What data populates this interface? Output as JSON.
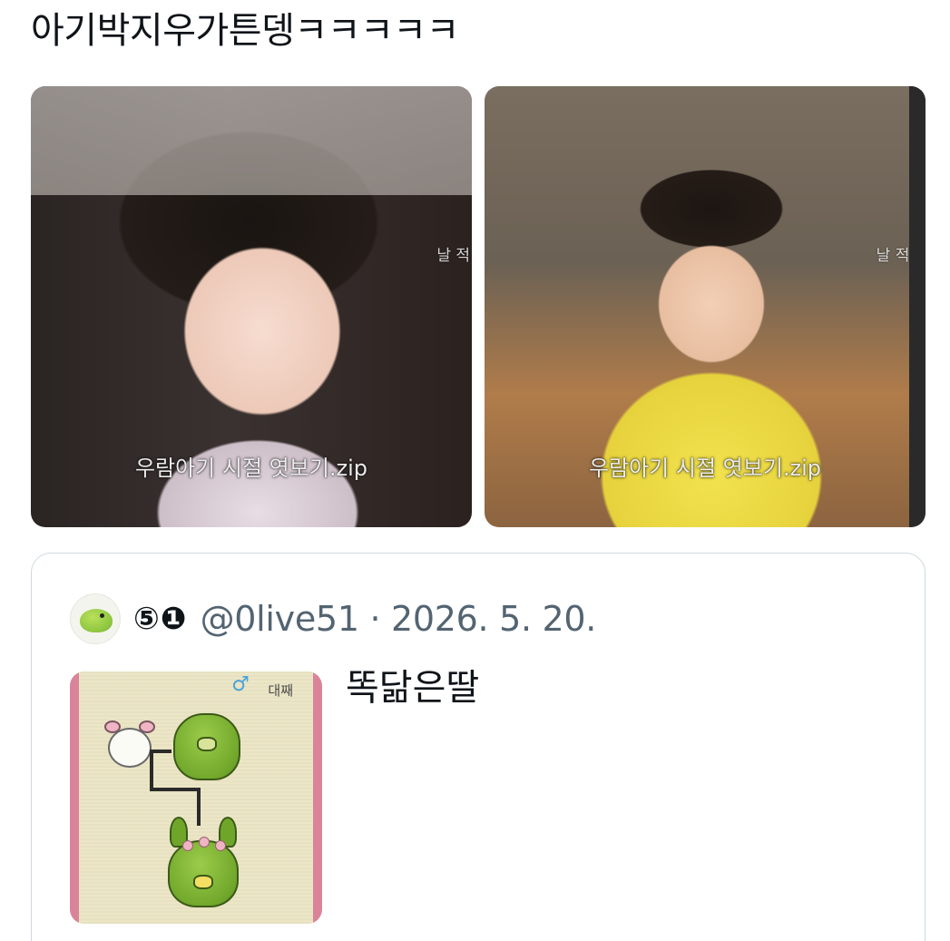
{
  "tweet": {
    "text": "아기박지우가튼뎅ㅋㅋㅋㅋㅋ"
  },
  "media": [
    {
      "caption": "우람아기 시절 엿보기.zip",
      "watermark": "날 적"
    },
    {
      "caption": "우람아기 시절 엿보기.zip",
      "watermark": "날 적바"
    }
  ],
  "quoted_tweet": {
    "display_name": "⑤❶",
    "handle_and_date": "@0live51 · 2026. 5. 20.",
    "text": "똑닮은딸",
    "media": {
      "screen_label": "대째",
      "gender_symbol": "♂"
    }
  },
  "colors": {
    "text_primary": "#0f1419",
    "text_secondary": "#536471",
    "card_border": "#cfd9de",
    "screen_frame": "#d9849a"
  },
  "icons": {
    "avatar": "green-chick-avatar"
  }
}
